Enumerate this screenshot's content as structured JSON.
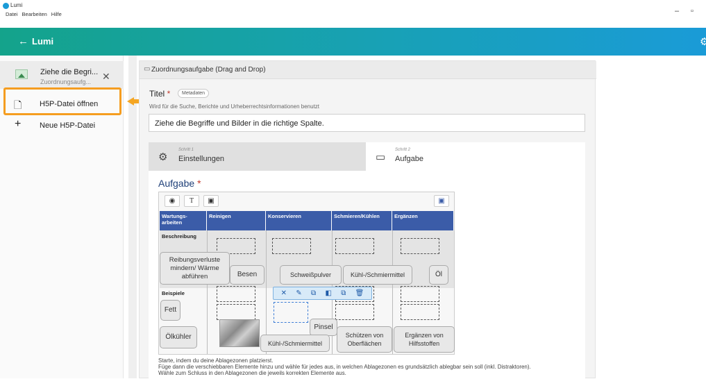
{
  "window": {
    "app_name": "Lumi",
    "menu": [
      "Datei",
      "Bearbeiten",
      "Hilfe"
    ],
    "minimize_glyph": "–",
    "restore_glyph": "▫"
  },
  "topbar": {
    "back_glyph": "←",
    "title": "Lumi",
    "gear_glyph": "⚙"
  },
  "sidebar": {
    "open_file": {
      "name": "Ziehe die Begri...",
      "subtitle": "Zuordnungsaufg...",
      "close_glyph": "✕"
    },
    "items": [
      {
        "label": "H5P-Datei öffnen",
        "icon_glyph": "🗋"
      },
      {
        "label": "Neue H5P-Datei",
        "icon_glyph": "+"
      }
    ]
  },
  "content": {
    "header": {
      "icon_glyph": "▭",
      "text": "Zuordnungsaufgabe (Drag and Drop)"
    },
    "title_field": {
      "label": "Titel",
      "required_mark": "*",
      "metadata_button": "Metadaten",
      "description": "Wird für die Suche, Berichte und Urheberrechtsinformationen benutzt",
      "value": "Ziehe die Begriffe und Bilder in die richtige Spalte."
    },
    "steps": [
      {
        "small": "Schritt 1",
        "label": "Einstellungen",
        "icon_glyph": "⚙"
      },
      {
        "small": "Schritt 2",
        "label": "Aufgabe",
        "icon_glyph": "▭"
      }
    ],
    "aufgabe": {
      "title": "Aufgabe",
      "required_mark": "*",
      "toolbar": [
        "◉",
        "T",
        "▣"
      ],
      "toolbar_right": "▣",
      "columns": [
        "Wartungs- arbeiten",
        "Reinigen",
        "Konservieren",
        "Schmieren/Kühlen",
        "Ergänzen"
      ],
      "rows": [
        "Beschreibung",
        "Beispiele"
      ],
      "chips": [
        "Reibungsverluste mindern/ Wärme abführen",
        "Besen",
        "Schweißpulver",
        "Kühl-/Schmiermittel",
        "Öl",
        "Fett",
        "Pinsel",
        "Ölkühler",
        "Kühl-/Schmiermittel",
        "Schützen von Oberflächen",
        "Ergänzen von Hilfsstoffen"
      ],
      "element_toolbar": [
        "✕",
        "✎",
        "⧉",
        "◧",
        "⧉",
        "🗑"
      ],
      "notes": [
        "Starte, indem du deine Ablagezonen platzierst.",
        "Füge dann die verschiebbaren Elemente hinzu und wähle für jedes aus, in welchen Ablagezonen es grundsätzlich ablegbar sein soll (inkl. Distraktoren).",
        "Wähle zum Schluss in den Ablagezonen die jeweils korrekten Elemente aus."
      ]
    }
  },
  "colors": {
    "topbar_start": "#14a38b",
    "topbar_end": "#1a9bd7",
    "highlight": "#f59d20",
    "table_header": "#3b5ca8",
    "aufgabe_title": "#1e3f78"
  }
}
